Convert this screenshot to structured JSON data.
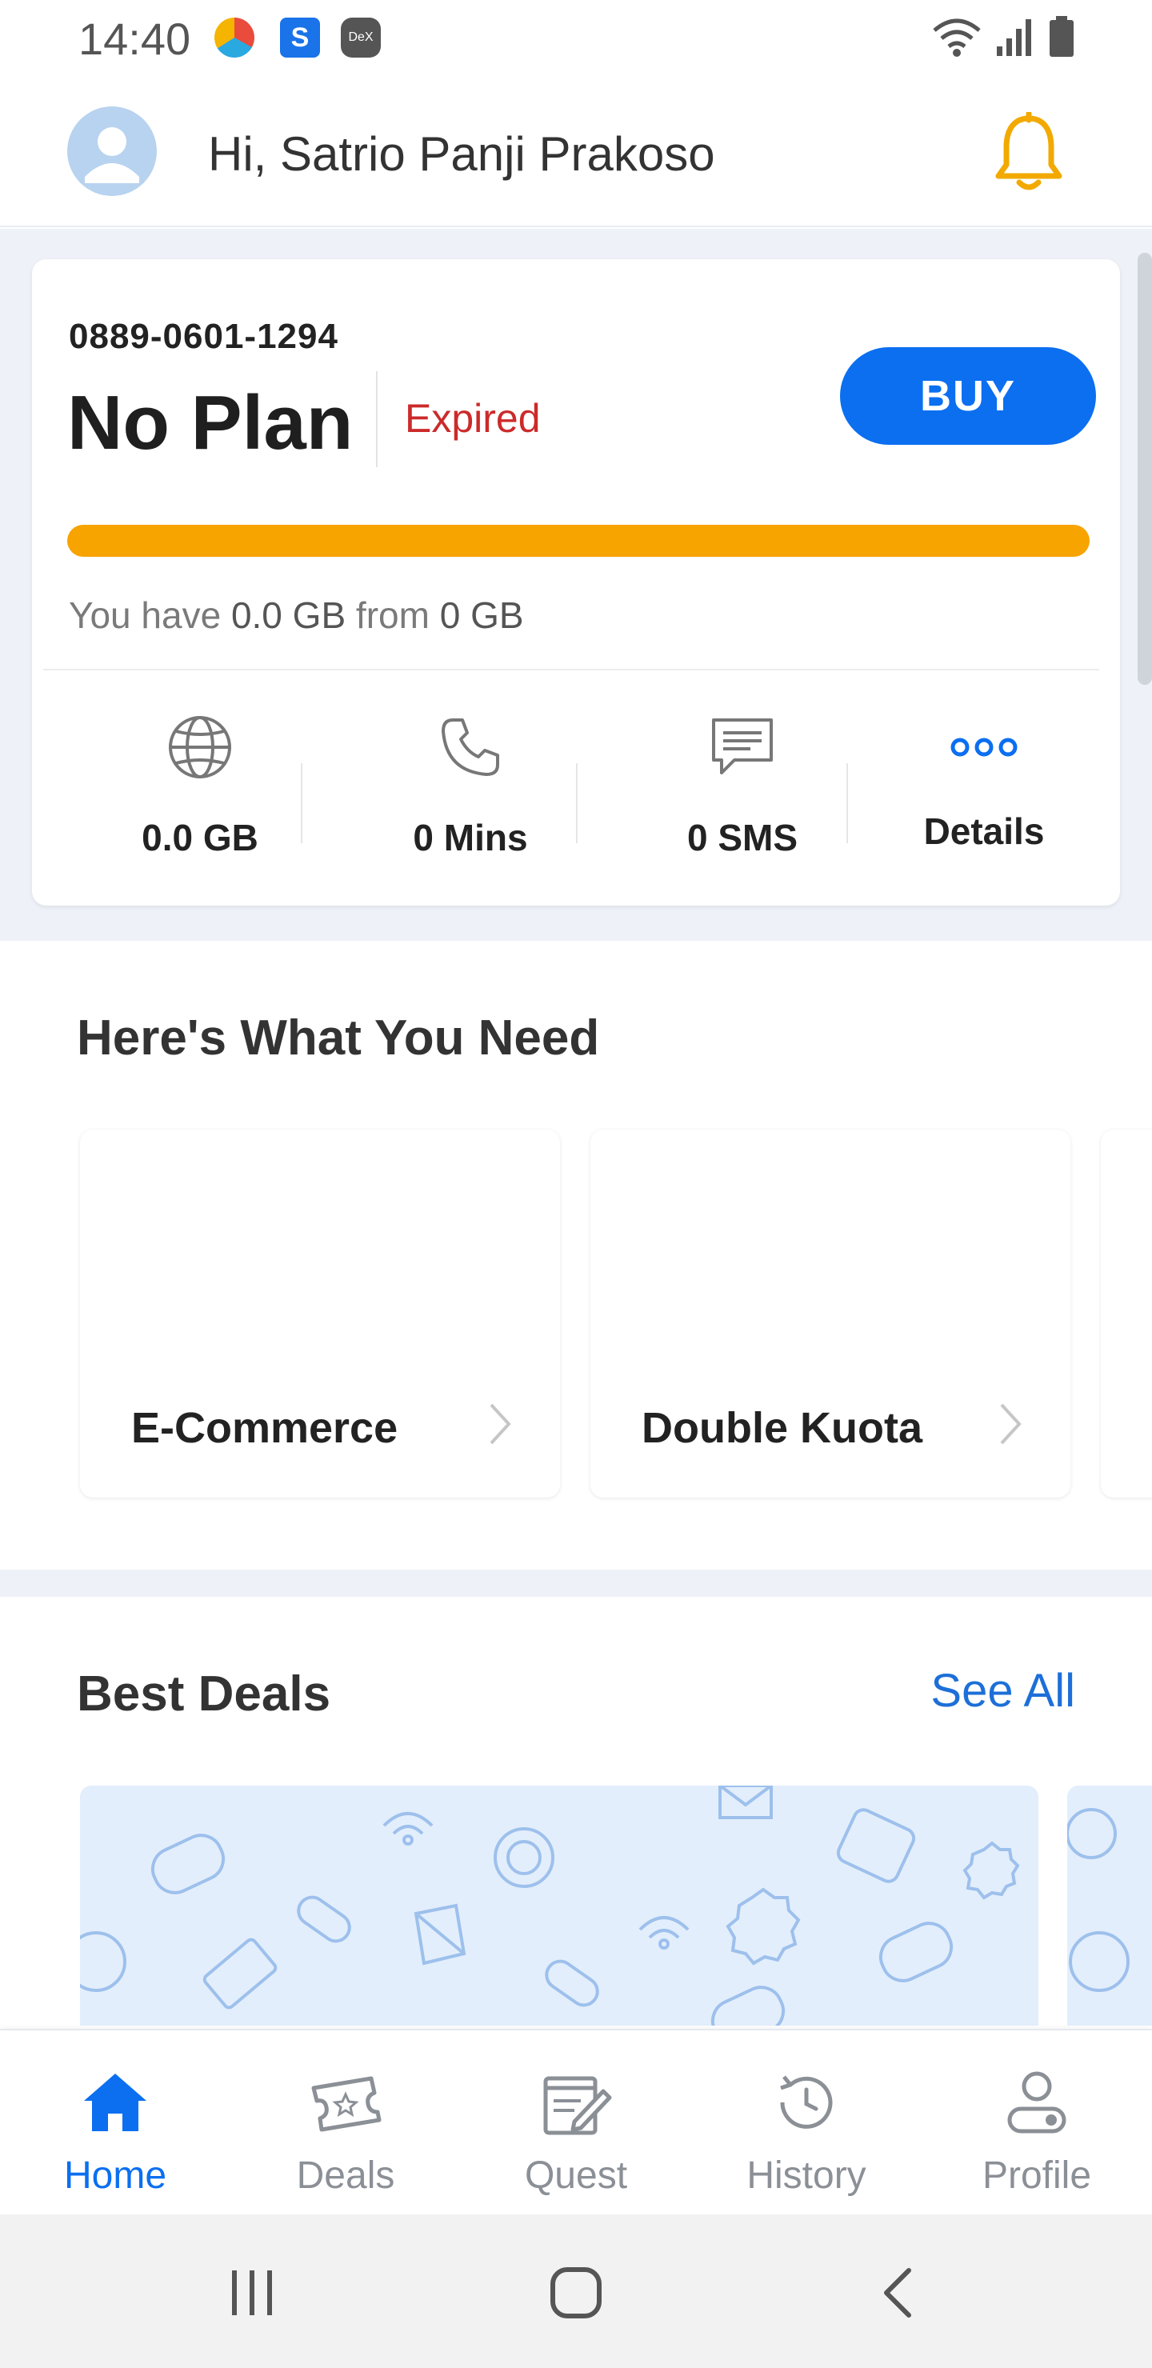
{
  "status_bar": {
    "time": "14:40",
    "app_icons": [
      "chrome-like-icon",
      "s-app-icon",
      "dex-icon"
    ],
    "dex_label": "DeX"
  },
  "header": {
    "greeting": "Hi, Satrio Panji Prakoso"
  },
  "plan": {
    "msisdn": "0889-0601-1294",
    "name": "No Plan",
    "status": "Expired",
    "buy_label": "BUY",
    "quota_prefix": "You have ",
    "quota_used": "0.0 GB",
    "quota_mid": " from ",
    "quota_total": "0 GB",
    "progress_fraction": 1.0,
    "stats": [
      {
        "icon": "globe-icon",
        "value": "0.0 GB"
      },
      {
        "icon": "phone-icon",
        "value": "0 Mins"
      },
      {
        "icon": "message-icon",
        "value": "0 SMS"
      },
      {
        "icon": "more-dots-icon",
        "value": "Details"
      }
    ]
  },
  "needs": {
    "title": "Here's What You Need",
    "cards": [
      {
        "label": "E-Commerce"
      },
      {
        "label": "Double Kuota"
      }
    ]
  },
  "deals": {
    "title": "Best Deals",
    "see_all": "See All"
  },
  "bottom_nav": {
    "items": [
      {
        "label": "Home",
        "icon": "home-icon",
        "active": true
      },
      {
        "label": "Deals",
        "icon": "ticket-icon",
        "active": false
      },
      {
        "label": "Quest",
        "icon": "quest-icon",
        "active": false
      },
      {
        "label": "History",
        "icon": "history-icon",
        "active": false
      },
      {
        "label": "Profile",
        "icon": "profile-icon",
        "active": false
      }
    ]
  },
  "colors": {
    "primary": "#0b6ff0",
    "progress": "#f7a300",
    "expired": "#cc2a2a",
    "bell": "#f2a900",
    "background": "#eef2f8"
  }
}
